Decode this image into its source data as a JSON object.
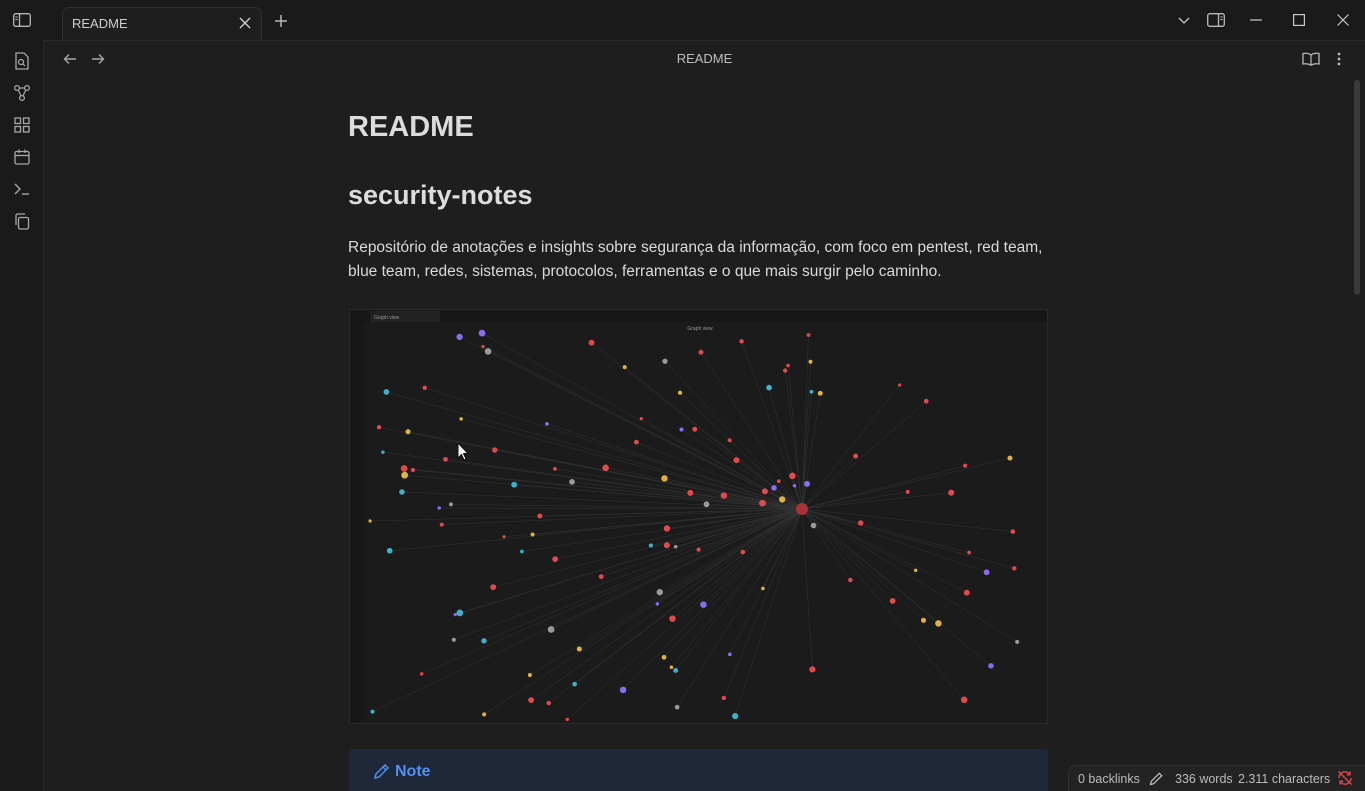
{
  "tabs": [
    {
      "title": "README"
    }
  ],
  "view": {
    "title": "README"
  },
  "doc": {
    "h1": "README",
    "h2": "security-notes",
    "paragraph": "Repositório de anotações e insights sobre segurança da informação, com foco em pentest, red team, blue team, redes, sistemas, protocolos, ferramentas e o que mais surgir pelo caminho.",
    "image": {
      "window_tab": "Graph view",
      "window_title": "Graph view"
    },
    "callout": {
      "title": "Note"
    }
  },
  "status": {
    "backlinks": "0 backlinks",
    "words": "336 words",
    "characters": "2.311 characters"
  },
  "colors": {
    "accent": "#4f8ff0",
    "background": "#1e1e1e",
    "node_red": "#e04a4f",
    "node_yellow": "#e0b33a",
    "node_cyan": "#3fb0c8",
    "node_purple": "#8a6cf0",
    "node_gray": "#9a9a9a"
  }
}
